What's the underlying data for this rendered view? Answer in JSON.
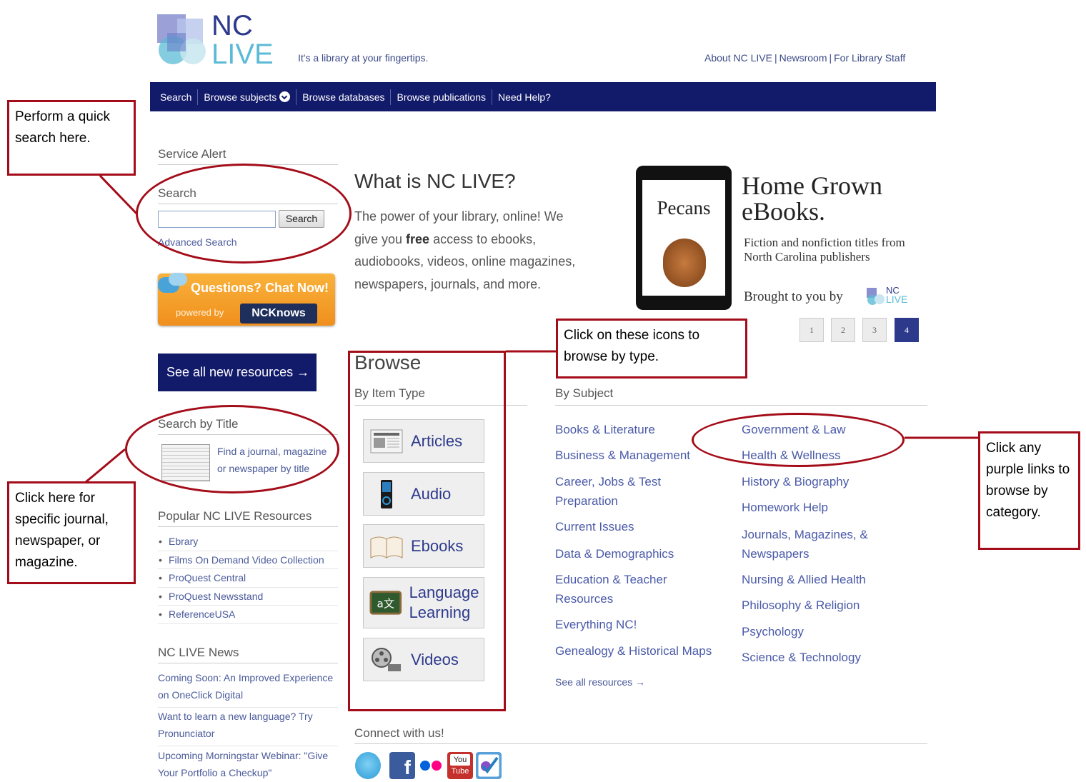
{
  "header": {
    "logo_nc": "NC",
    "logo_live": "LIVE",
    "tagline": "It's a library at your fingertips.",
    "top_links": [
      "About NC LIVE",
      "Newsroom",
      "For Library Staff"
    ]
  },
  "nav": {
    "items": [
      "Search",
      "Browse subjects",
      "Browse databases",
      "Browse publications",
      "Need Help?"
    ]
  },
  "sidebar": {
    "service_alert": "Service Alert",
    "search_heading": "Search",
    "search_value": "",
    "search_button": "Search",
    "advanced_search": "Advanced Search",
    "chat_title": "Questions? Chat Now!",
    "chat_powered": "powered by",
    "chat_brand": "NCKnows",
    "see_all_new": "See all new resources →",
    "search_by_title_heading": "Search by Title",
    "search_by_title_link": "Find a journal, magazine or newspaper by title",
    "popular_heading": "Popular NC LIVE Resources",
    "popular": [
      "Ebrary",
      "Films On Demand Video Collection",
      "ProQuest Central",
      "ProQuest Newsstand",
      "ReferenceUSA"
    ],
    "news_heading": "NC LIVE News",
    "news": [
      "Coming Soon: An Improved Experience on OneClick Digital",
      "Want to learn a new language? Try Pronunciator",
      "Upcoming Morningstar Webinar: \"Give Your Portfolio a Checkup\""
    ]
  },
  "intro": {
    "heading": "What is NC LIVE?",
    "text_before": "The power of your library, online! We give you ",
    "text_bold": "free",
    "text_after": " access to ebooks, audiobooks, videos, online magazines, newspapers, journals, and more."
  },
  "carousel": {
    "book_title": "Pecans",
    "title_line1": "Home Grown",
    "title_line2": "eBooks.",
    "subtitle": "Fiction and nonfiction titles from North Carolina publishers",
    "brought_by": "Brought to you by",
    "logo_nc": "NC",
    "logo_live": "LIVE",
    "pages": [
      "1",
      "2",
      "3",
      "4"
    ],
    "active_page": 4
  },
  "browse": {
    "heading": "Browse",
    "by_type_heading": "By Item Type",
    "types": [
      "Articles",
      "Audio",
      "Ebooks",
      "Language Learning",
      "Videos"
    ],
    "by_subject_heading": "By Subject",
    "subjects_left": [
      "Books & Literature",
      "Business & Management",
      "Career, Jobs & Test Preparation",
      "Current Issues",
      "Data & Demographics",
      "Education & Teacher Resources",
      "Everything NC!",
      "Genealogy & Historical Maps"
    ],
    "subjects_right": [
      "Government & Law",
      "Health & Wellness",
      "History & Biography",
      "Homework Help",
      "Journals, Magazines, & Newspapers",
      "Nursing & Allied Health",
      "Philosophy & Religion",
      "Psychology",
      "Science & Technology"
    ],
    "see_all": "See all resources →"
  },
  "connect": {
    "heading": "Connect with us!",
    "icons": [
      "twitter-icon",
      "facebook-icon",
      "flickr-icon",
      "youtube-icon",
      "checkin-icon"
    ],
    "youtube_top": "You",
    "youtube_bottom": "Tube"
  },
  "annotations": {
    "search": "Perform a quick search here.",
    "title": "Click here for specific journal, newspaper, or magazine.",
    "type": "Click on these icons to browse by type.",
    "category": "Click any purple links to browse by category."
  },
  "colors": {
    "nav": "#121a6a",
    "annotation": "#a30c18",
    "link": "#4a5aa8"
  }
}
